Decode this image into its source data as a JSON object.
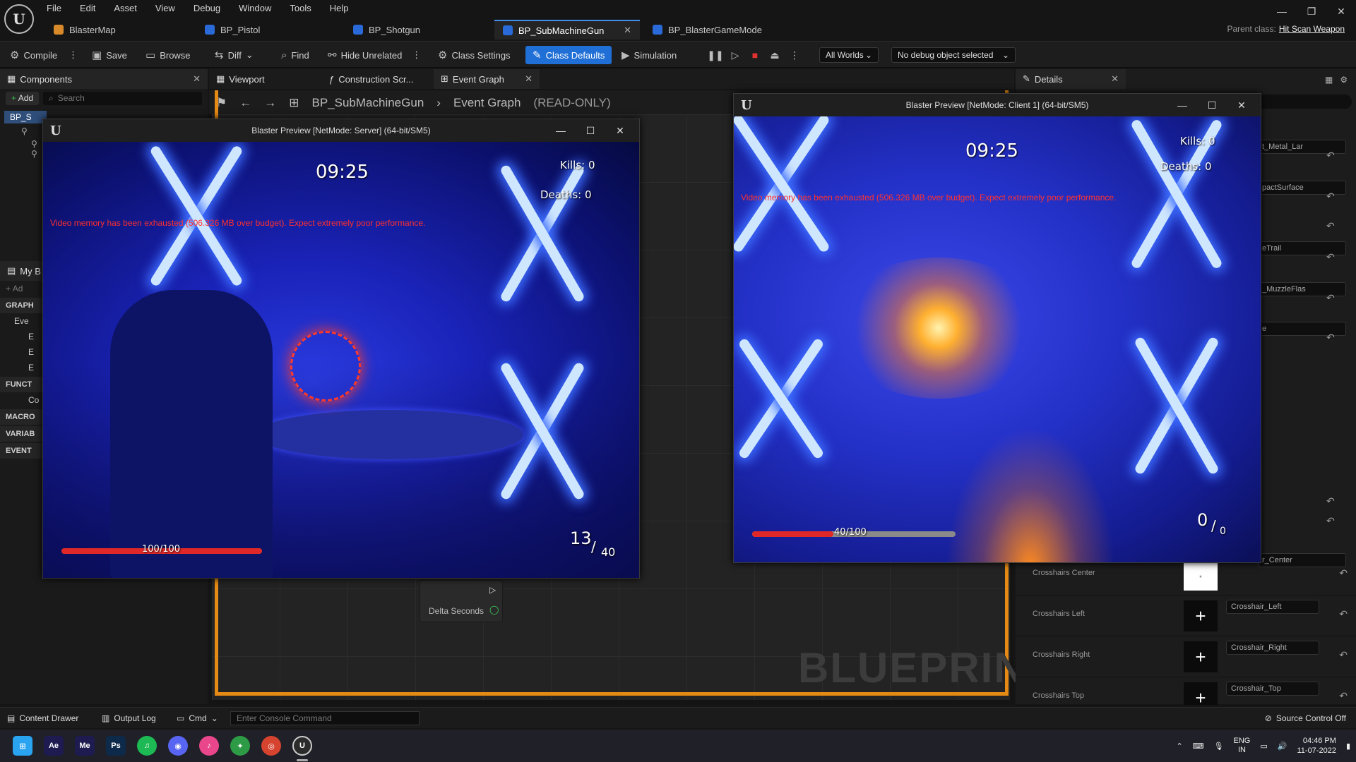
{
  "menu": [
    "File",
    "Edit",
    "Asset",
    "View",
    "Debug",
    "Window",
    "Tools",
    "Help"
  ],
  "doc_tabs": [
    {
      "label": "BlasterMap",
      "color": "#d88a2b"
    },
    {
      "label": "BP_Pistol",
      "color": "#2a6ad8"
    },
    {
      "label": "BP_Shotgun",
      "color": "#2a6ad8"
    },
    {
      "label": "BP_SubMachineGun",
      "color": "#2a6ad8",
      "active": true
    },
    {
      "label": "BP_BlasterGameMode",
      "color": "#2a6ad8"
    }
  ],
  "parent_class": {
    "label": "Parent class:",
    "value": "Hit Scan Weapon"
  },
  "toolbar": {
    "compile": "Compile",
    "save": "Save",
    "browse": "Browse",
    "diff": "Diff",
    "find": "Find",
    "hide_unrelated": "Hide Unrelated",
    "class_settings": "Class Settings",
    "class_defaults": "Class Defaults",
    "simulation": "Simulation",
    "world": "All Worlds",
    "debug_object": "No debug object selected"
  },
  "components_panel": {
    "title": "Components",
    "add": "Add",
    "search_placeholder": "Search",
    "root": "BP_S"
  },
  "mybp_panel": {
    "title": "My B",
    "add": "Ad",
    "sections": [
      "GRAPH",
      "FUNCT",
      "MACRO",
      "VARIAB",
      "EVENT"
    ],
    "graph_items": [
      "Eve",
      "E",
      "E",
      "E"
    ],
    "func_item": "Co"
  },
  "graph_tabs": {
    "viewport": "Viewport",
    "construction": "Construction Scr...",
    "event_graph": "Event Graph"
  },
  "breadcrumb": {
    "blueprint": "BP_SubMachineGun",
    "graph": "Event Graph",
    "mode": "(READ-ONLY)"
  },
  "node": {
    "pin": "Delta Seconds"
  },
  "watermark": "BLUEPRINT",
  "details": {
    "title": "Details",
    "partial_values": [
      "t_Metal_Lar",
      "pactSurface",
      "eTrail",
      "_MuzzleFlas",
      "e",
      "r_Center"
    ],
    "rows": [
      {
        "label": "Crosshairs Center",
        "value": "",
        "thumb": "·"
      },
      {
        "label": "Crosshairs Left",
        "value": "Crosshair_Left",
        "thumb": "+"
      },
      {
        "label": "Crosshairs Right",
        "value": "Crosshair_Right",
        "thumb": "+"
      },
      {
        "label": "Crosshairs Top",
        "value": "Crosshair_Top",
        "thumb": "+"
      }
    ]
  },
  "server_window": {
    "title": "Blaster Preview [NetMode: Server]  (64-bit/SM5)",
    "timer": "09:25",
    "kills_label": "Kills:",
    "kills": "0",
    "deaths_label": "Deaths:",
    "deaths": "0",
    "warning": "Video memory has been exhausted (506.326 MB over budget). Expect extremely poor performance.",
    "health": "100/100",
    "health_fraction": 1.0,
    "ammo": "13",
    "carried": "40"
  },
  "client_window": {
    "title": "Blaster Preview [NetMode: Client 1]  (64-bit/SM5)",
    "timer": "09:25",
    "kills_label": "Kills:",
    "kills": "0",
    "deaths_label": "Deaths:",
    "deaths": "0",
    "warning": "Video memory has been exhausted (506.326 MB over budget). Expect extremely poor performance.",
    "health": "40/100",
    "health_fraction": 0.4,
    "ammo": "0",
    "carried": "0"
  },
  "bottom": {
    "content_drawer": "Content Drawer",
    "output_log": "Output Log",
    "cmd": "Cmd",
    "console_placeholder": "Enter Console Command",
    "source_control": "Source Control Off"
  },
  "taskbar": {
    "apps": [
      {
        "name": "windows-start",
        "glyph": "⊞",
        "color": "#2aa3f0"
      },
      {
        "name": "after-effects",
        "glyph": "Ae",
        "color": "#1d1b4f"
      },
      {
        "name": "media-encoder",
        "glyph": "Me",
        "color": "#1d1b4f"
      },
      {
        "name": "photoshop",
        "glyph": "Ps",
        "color": "#0d2a4a"
      },
      {
        "name": "spotify",
        "glyph": "♫",
        "color": "#1db954"
      },
      {
        "name": "discord",
        "glyph": "◉",
        "color": "#5865f2"
      },
      {
        "name": "itunes",
        "glyph": "♪",
        "color": "#e9468b"
      },
      {
        "name": "razer",
        "glyph": "✦",
        "color": "#2d9b45"
      },
      {
        "name": "chrome",
        "glyph": "◎",
        "color": "#d6432f"
      },
      {
        "name": "unreal",
        "glyph": "U",
        "color": "#2b2b2b"
      }
    ],
    "lang": "ENG",
    "region": "IN",
    "time": "04:46 PM",
    "date": "11-07-2022"
  }
}
